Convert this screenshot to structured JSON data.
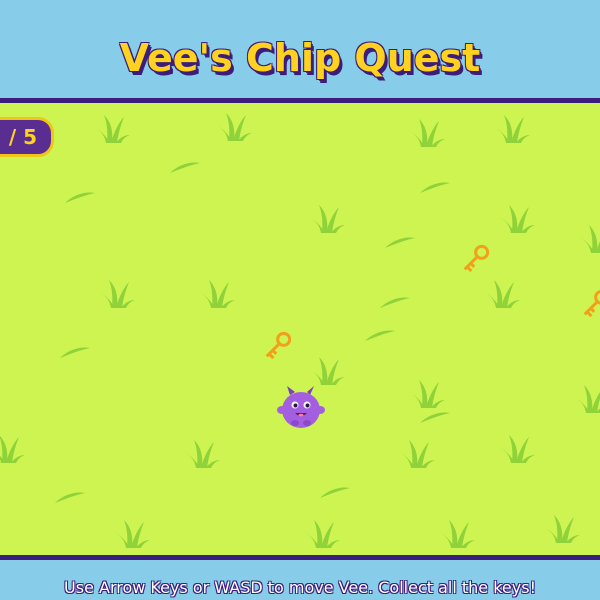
{
  "game": {
    "title": "Vee's Chip Quest",
    "instructions": "Use Arrow Keys or WASD to move Vee. Collect all the keys!",
    "counter_text": "/ 5"
  },
  "colors": {
    "sky": "#87cdea",
    "field": "#cdf451",
    "grass": "#8fd23a",
    "border": "#3d1d7a",
    "title": "#ffd21f",
    "key": "#f2a01c",
    "player": "#a45fe0"
  },
  "sprites": {
    "player": "vee-purple-monster",
    "collectible": "golden-key",
    "decoration": "grass-tuft"
  }
}
